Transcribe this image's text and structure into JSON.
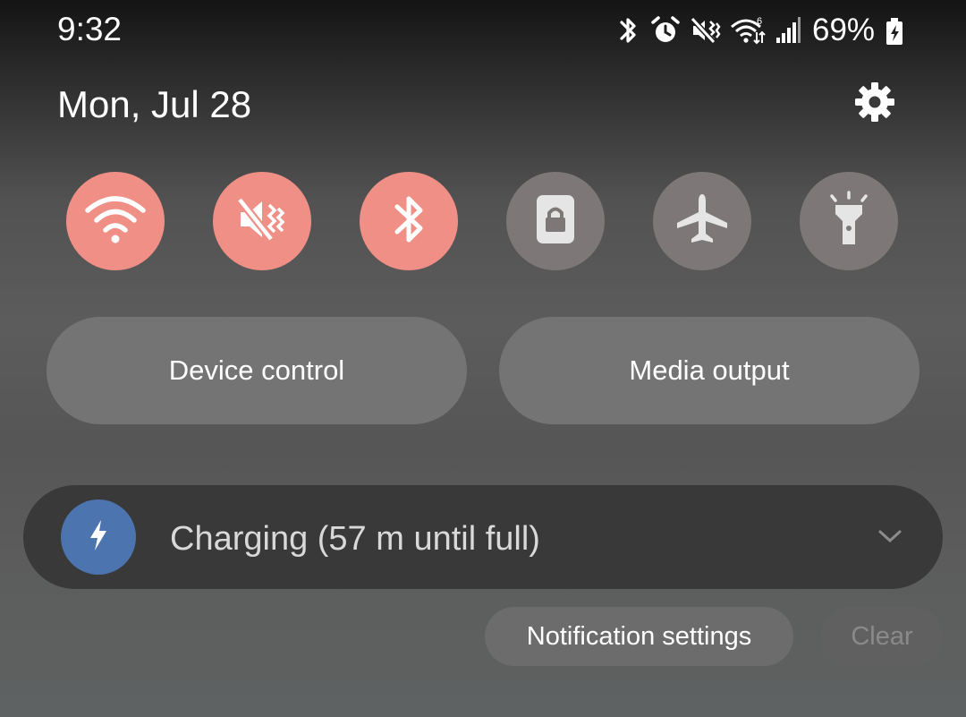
{
  "status_bar": {
    "time": "9:32",
    "icons": [
      "bluetooth-icon",
      "alarm-icon",
      "vibrate-icon",
      "wifi-6-icon",
      "signal-icon"
    ],
    "battery_percent": "69%",
    "battery_icon": "battery-charging-icon"
  },
  "header": {
    "date": "Mon, Jul 28",
    "settings_icon": "gear-icon"
  },
  "quick_toggles": [
    {
      "name": "Wi-Fi",
      "icon": "wifi-icon",
      "active": true
    },
    {
      "name": "Vibrate",
      "icon": "vibrate-icon",
      "active": true
    },
    {
      "name": "Bluetooth",
      "icon": "bluetooth-icon",
      "active": true
    },
    {
      "name": "Screen lock",
      "icon": "portrait-lock-icon",
      "active": false
    },
    {
      "name": "Airplane mode",
      "icon": "airplane-icon",
      "active": false
    },
    {
      "name": "Flashlight",
      "icon": "flashlight-icon",
      "active": false
    }
  ],
  "buttons": {
    "device_control": "Device control",
    "media_output": "Media output"
  },
  "notification": {
    "icon": "lightning-icon",
    "text": "Charging (57 m until full)",
    "expand_icon": "chevron-down-icon"
  },
  "footer": {
    "notification_settings": "Notification settings",
    "clear": "Clear"
  },
  "colors": {
    "toggle_on": "#ef8f86",
    "toggle_off": "#7d7877",
    "charge_circle": "#4c74ae",
    "notification_bg": "#393939"
  }
}
